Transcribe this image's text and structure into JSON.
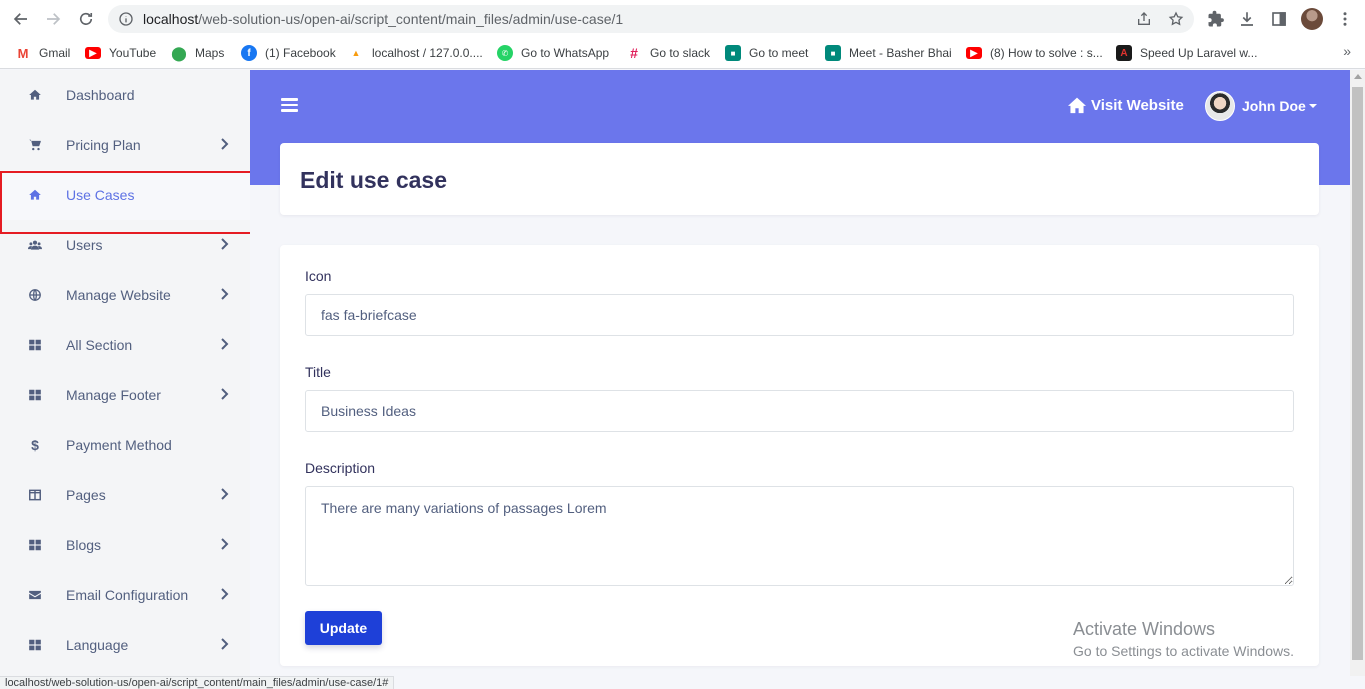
{
  "browser": {
    "url_host": "localhost",
    "url_path": "/web-solution-us/open-ai/script_content/main_files/admin/use-case/1",
    "bookmarks": [
      {
        "label": "Gmail",
        "icon": "gmail-icon",
        "color": "#ea4335"
      },
      {
        "label": "YouTube",
        "icon": "youtube-icon",
        "color": "#ff0000"
      },
      {
        "label": "Maps",
        "icon": "maps-icon",
        "color": "#34a853"
      },
      {
        "label": "(1) Facebook",
        "icon": "facebook-icon",
        "color": "#1877f2"
      },
      {
        "label": "localhost / 127.0.0....",
        "icon": "phpmyadmin-icon",
        "color": "#f89c0e"
      },
      {
        "label": "Go to WhatsApp",
        "icon": "whatsapp-icon",
        "color": "#25d366"
      },
      {
        "label": "Go to slack",
        "icon": "slack-icon",
        "color": "#e01e5a"
      },
      {
        "label": "Go to meet",
        "icon": "meet-icon",
        "color": "#00897b"
      },
      {
        "label": "Meet - Basher Bhai",
        "icon": "meet-icon",
        "color": "#00897b"
      },
      {
        "label": "(8) How to solve : s...",
        "icon": "youtube-icon",
        "color": "#ff0000"
      },
      {
        "label": "Speed Up Laravel w...",
        "icon": "laravel-icon",
        "color": "#1a1a1a"
      }
    ],
    "more": "»",
    "status_url": "localhost/web-solution-us/open-ai/script_content/main_files/admin/use-case/1#"
  },
  "sidebar": {
    "items": [
      {
        "label": "Dashboard",
        "icon": "home-icon",
        "has_children": false
      },
      {
        "label": "Pricing Plan",
        "icon": "cart-icon",
        "has_children": true
      },
      {
        "label": "Use Cases",
        "icon": "home-icon",
        "has_children": false,
        "active": true
      },
      {
        "label": "Users",
        "icon": "users-icon",
        "has_children": true
      },
      {
        "label": "Manage Website",
        "icon": "globe-icon",
        "has_children": true
      },
      {
        "label": "All Section",
        "icon": "grid-icon",
        "has_children": true
      },
      {
        "label": "Manage Footer",
        "icon": "grid-icon",
        "has_children": true
      },
      {
        "label": "Payment Method",
        "icon": "dollar-icon",
        "has_children": false
      },
      {
        "label": "Pages",
        "icon": "columns-icon",
        "has_children": true
      },
      {
        "label": "Blogs",
        "icon": "grid-icon",
        "has_children": true
      },
      {
        "label": "Email Configuration",
        "icon": "envelope-icon",
        "has_children": true
      },
      {
        "label": "Language",
        "icon": "grid-icon",
        "has_children": true
      }
    ]
  },
  "topbar": {
    "visit_label": "Visit Website",
    "user_name": "John Doe"
  },
  "page": {
    "title": "Edit use case"
  },
  "form": {
    "icon_label": "Icon",
    "icon_value": "fas fa-briefcase",
    "title_label": "Title",
    "title_value": "Business Ideas",
    "description_label": "Description",
    "description_value": "There are many variations of passages Lorem",
    "update_label": "Update"
  },
  "watermark": {
    "line1": "Activate Windows",
    "line2": "Go to Settings to activate Windows."
  },
  "colors": {
    "accent": "#5e72e4",
    "topbar": "#6b76ec",
    "button": "#1e40d8",
    "highlight": "#e51c23"
  }
}
